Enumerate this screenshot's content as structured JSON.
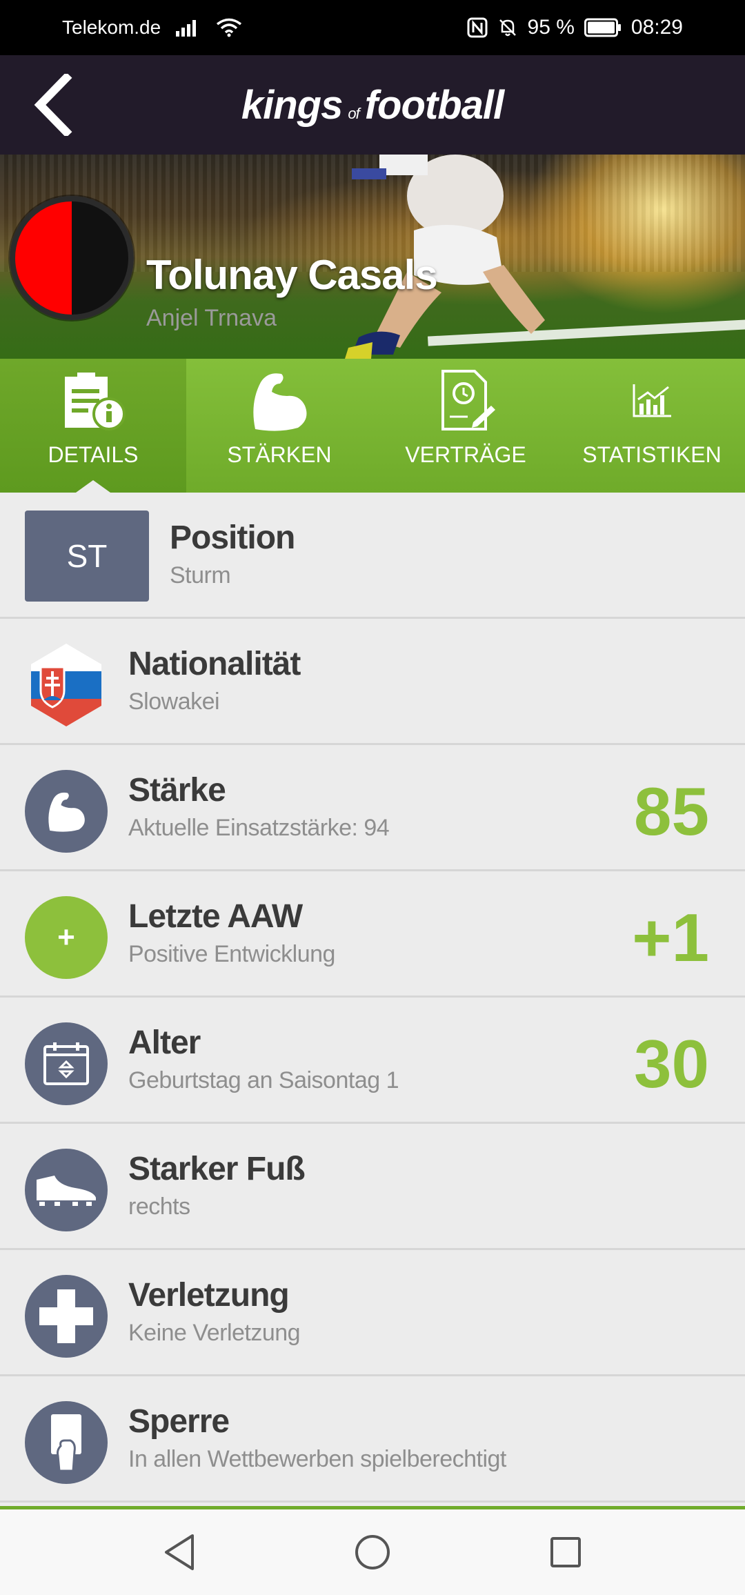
{
  "status_bar": {
    "carrier": "Telekom.de",
    "battery": "95 %",
    "time": "08:29"
  },
  "app_bar": {
    "logo_part1": "kings",
    "logo_part2": "of",
    "logo_part3": "football"
  },
  "player": {
    "name": "Tolunay Casals",
    "club": "Anjel Trnava"
  },
  "tabs": [
    {
      "label": "DETAILS",
      "icon": "details-icon",
      "active": true
    },
    {
      "label": "STÄRKEN",
      "icon": "muscle-icon",
      "active": false
    },
    {
      "label": "VERTRÄGE",
      "icon": "contract-icon",
      "active": false
    },
    {
      "label": "STATISTIKEN",
      "icon": "stats-icon",
      "active": false
    }
  ],
  "details": {
    "position": {
      "code": "ST",
      "title": "Position",
      "sub": "Sturm"
    },
    "nationality": {
      "title": "Nationalität",
      "sub": "Slowakei"
    },
    "strength": {
      "title": "Stärke",
      "sub": "Aktuelle Einsatzstärke: 94",
      "value": "85"
    },
    "last_aaw": {
      "title": "Letzte AAW",
      "sub": "Positive Entwicklung",
      "value": "+1",
      "badge": "+"
    },
    "age": {
      "title": "Alter",
      "sub": "Geburtstag an Saisontag 1",
      "value": "30"
    },
    "foot": {
      "title": "Starker Fuß",
      "sub": "rechts"
    },
    "injury": {
      "title": "Verletzung",
      "sub": "Keine Verletzung"
    },
    "suspension": {
      "title": "Sperre",
      "sub": "In allen Wettbewerben spielberechtigt"
    }
  },
  "colors": {
    "accent_green": "#8dc03c",
    "icon_slate": "#5f6880",
    "app_bar": "#221b2a",
    "club_primary": "#ff0000",
    "club_secondary": "#111111"
  }
}
